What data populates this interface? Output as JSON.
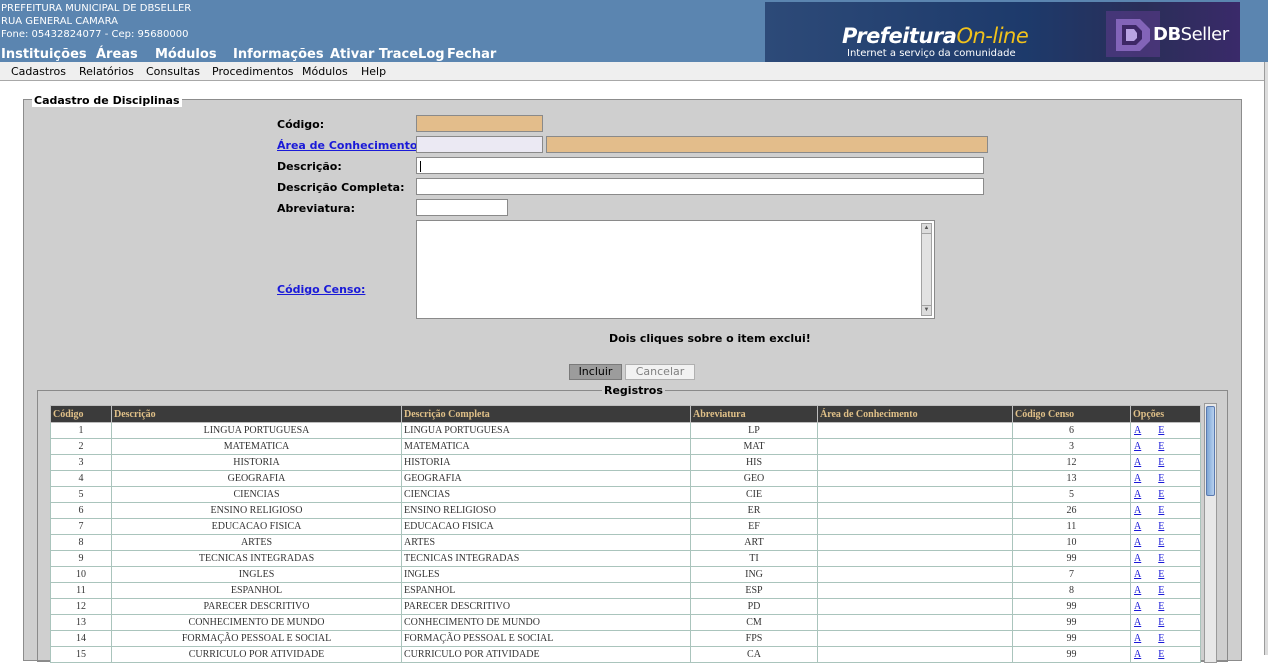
{
  "header": {
    "line1": "PREFEITURA MUNICIPAL DE DBSELLER",
    "line2": "RUA GENERAL CAMARA",
    "line3": "Fone: 05432824077  -  Cep: 95680000",
    "nav": [
      "Instituições",
      "Áreas",
      "Módulos",
      "Informações",
      "Ativar TraceLog",
      "Fechar"
    ]
  },
  "banner": {
    "logo_main": "Prefeitura",
    "logo_accent": "On-line",
    "logo_tagline": "Internet a serviço da comunidade",
    "brand_bold": "DB",
    "brand_rest": "Seller"
  },
  "menu": [
    "Cadastros",
    "Relatórios",
    "Consultas",
    "Procedimentos",
    "Módulos",
    "Help"
  ],
  "form": {
    "legend": "Cadastro de Disciplinas",
    "codigo_label": "Código:",
    "area_label": "Área de Conhecimento:",
    "descricao_label": "Descrição:",
    "descricao_completa_label": "Descrição Completa:",
    "abreviatura_label": "Abreviatura:",
    "codigo_censo_label": "Código Censo:",
    "notice": "Dois cliques sobre o item exclui!",
    "incluir": "Incluir",
    "cancelar": "Cancelar",
    "colors": {
      "readonly": "#e3bd8b",
      "link": "#1a1ad8"
    }
  },
  "registros": {
    "legend": "Registros",
    "columns": [
      "Código",
      "Descrição",
      "Descrição Completa",
      "Abreviatura",
      "Área de Conhecimento",
      "Código Censo",
      "Opções"
    ],
    "option_alter": "A",
    "option_excluir": "E",
    "rows": [
      {
        "codigo": "1",
        "descricao": "LINGUA PORTUGUESA",
        "descricao_completa": "LINGUA PORTUGUESA",
        "abreviatura": "LP",
        "area": "",
        "censo": "6"
      },
      {
        "codigo": "2",
        "descricao": "MATEMATICA",
        "descricao_completa": "MATEMATICA",
        "abreviatura": "MAT",
        "area": "",
        "censo": "3"
      },
      {
        "codigo": "3",
        "descricao": "HISTORIA",
        "descricao_completa": "HISTORIA",
        "abreviatura": "HIS",
        "area": "",
        "censo": "12"
      },
      {
        "codigo": "4",
        "descricao": "GEOGRAFIA",
        "descricao_completa": "GEOGRAFIA",
        "abreviatura": "GEO",
        "area": "",
        "censo": "13"
      },
      {
        "codigo": "5",
        "descricao": "CIENCIAS",
        "descricao_completa": "CIENCIAS",
        "abreviatura": "CIE",
        "area": "",
        "censo": "5"
      },
      {
        "codigo": "6",
        "descricao": "ENSINO RELIGIOSO",
        "descricao_completa": "ENSINO RELIGIOSO",
        "abreviatura": "ER",
        "area": "",
        "censo": "26"
      },
      {
        "codigo": "7",
        "descricao": "EDUCACAO FISICA",
        "descricao_completa": "EDUCACAO FISICA",
        "abreviatura": "EF",
        "area": "",
        "censo": "11"
      },
      {
        "codigo": "8",
        "descricao": "ARTES",
        "descricao_completa": "ARTES",
        "abreviatura": "ART",
        "area": "",
        "censo": "10"
      },
      {
        "codigo": "9",
        "descricao": "TECNICAS INTEGRADAS",
        "descricao_completa": "TECNICAS INTEGRADAS",
        "abreviatura": "TI",
        "area": "",
        "censo": "99"
      },
      {
        "codigo": "10",
        "descricao": "INGLES",
        "descricao_completa": "INGLES",
        "abreviatura": "ING",
        "area": "",
        "censo": "7"
      },
      {
        "codigo": "11",
        "descricao": "ESPANHOL",
        "descricao_completa": "ESPANHOL",
        "abreviatura": "ESP",
        "area": "",
        "censo": "8"
      },
      {
        "codigo": "12",
        "descricao": "PARECER DESCRITIVO",
        "descricao_completa": "PARECER DESCRITIVO",
        "abreviatura": "PD",
        "area": "",
        "censo": "99"
      },
      {
        "codigo": "13",
        "descricao": "CONHECIMENTO DE MUNDO",
        "descricao_completa": "CONHECIMENTO DE MUNDO",
        "abreviatura": "CM",
        "area": "",
        "censo": "99"
      },
      {
        "codigo": "14",
        "descricao": "FORMAÇÃO PESSOAL E SOCIAL",
        "descricao_completa": "FORMAÇÃO PESSOAL E SOCIAL",
        "abreviatura": "FPS",
        "area": "",
        "censo": "99"
      },
      {
        "codigo": "15",
        "descricao": "CURRICULO POR ATIVIDADE",
        "descricao_completa": "CURRICULO POR ATIVIDADE",
        "abreviatura": "CA",
        "area": "",
        "censo": "99"
      }
    ]
  }
}
